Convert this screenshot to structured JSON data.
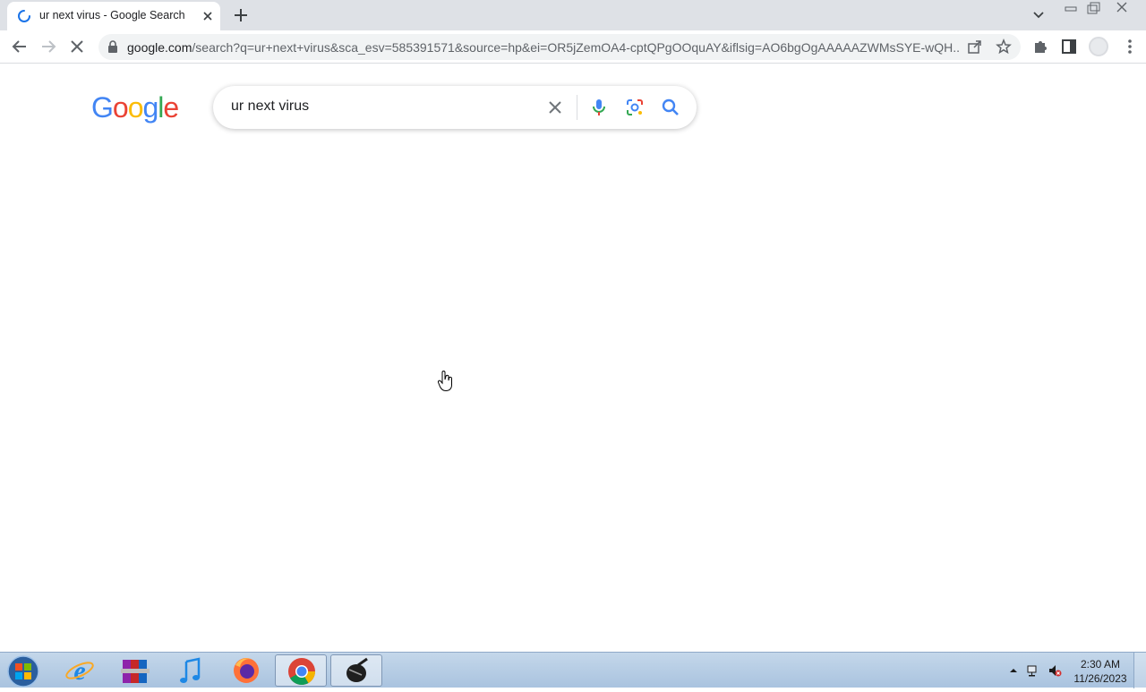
{
  "browser": {
    "tab": {
      "title": "ur next virus - Google Search",
      "icon": "loading-spinner-icon"
    },
    "address_bar": {
      "host": "google.com",
      "path": "/search?q=ur+next+virus&sca_esv=585391571&source=hp&ei=OR5jZemOA4-cptQPgOOquAY&iflsig=AO6bgOgAAAAAZWMsSYE-wQH..."
    },
    "icons": {
      "back": "back-arrow-icon",
      "forward": "forward-arrow-icon",
      "reload": "stop-loading-icon",
      "share": "share-icon",
      "bookmark": "star-icon",
      "extensions": "puzzle-icon",
      "side_panel": "side-panel-icon",
      "profile": "avatar-icon"
    }
  },
  "page": {
    "logo": {
      "letters": [
        "G",
        "o",
        "o",
        "g",
        "l",
        "e"
      ],
      "colors": [
        "#4285F4",
        "#EA4335",
        "#FBBC05",
        "#4285F4",
        "#34A853",
        "#EA4335"
      ]
    },
    "search": {
      "query": "ur next virus"
    }
  },
  "taskbar": {
    "apps": [
      "internet-explorer",
      "winrar",
      "itunes",
      "firefox",
      "chrome",
      "app"
    ],
    "clock": {
      "time": "2:30 AM",
      "date": "11/26/2023"
    }
  }
}
